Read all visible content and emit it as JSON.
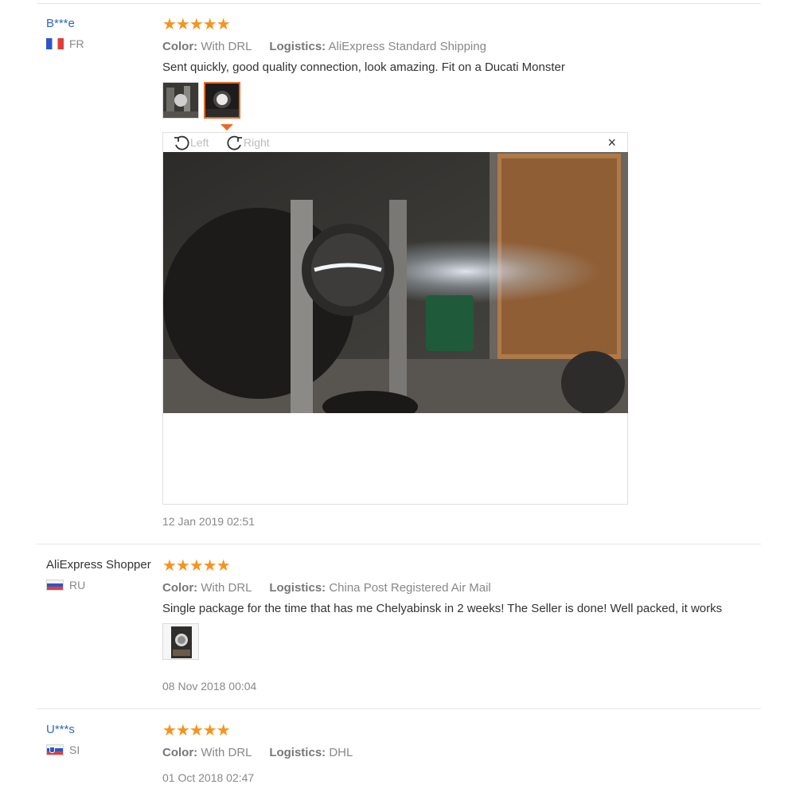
{
  "stars": "★★★★★",
  "labels": {
    "color": "Color:",
    "logistics": "Logistics:"
  },
  "viewer": {
    "rotate_left": "Left",
    "rotate_right": "Right",
    "close": "×"
  },
  "reviews": [
    {
      "user": "B***e",
      "country": "FR",
      "color": "With DRL",
      "logistics": "AliExpress Standard Shipping",
      "text": "Sent quickly, good quality connection, look amazing. Fit on a Ducati Monster",
      "date": "12 Jan 2019 02:51"
    },
    {
      "user": "AliExpress Shopper",
      "country": "RU",
      "color": "With DRL",
      "logistics": "China Post Registered Air Mail",
      "text": "Single package for the time that has me Chelyabinsk in 2 weeks! The Seller is done! Well packed, it works",
      "date": "08 Nov 2018 00:04"
    },
    {
      "user": "U***s",
      "country": "SI",
      "color": "With DRL",
      "logistics": "DHL",
      "date": "01 Oct 2018 02:47"
    }
  ],
  "colors": {
    "star": "#f7931e",
    "link": "#2f67c1",
    "active_border": "#e86a24",
    "muted": "#888888"
  }
}
